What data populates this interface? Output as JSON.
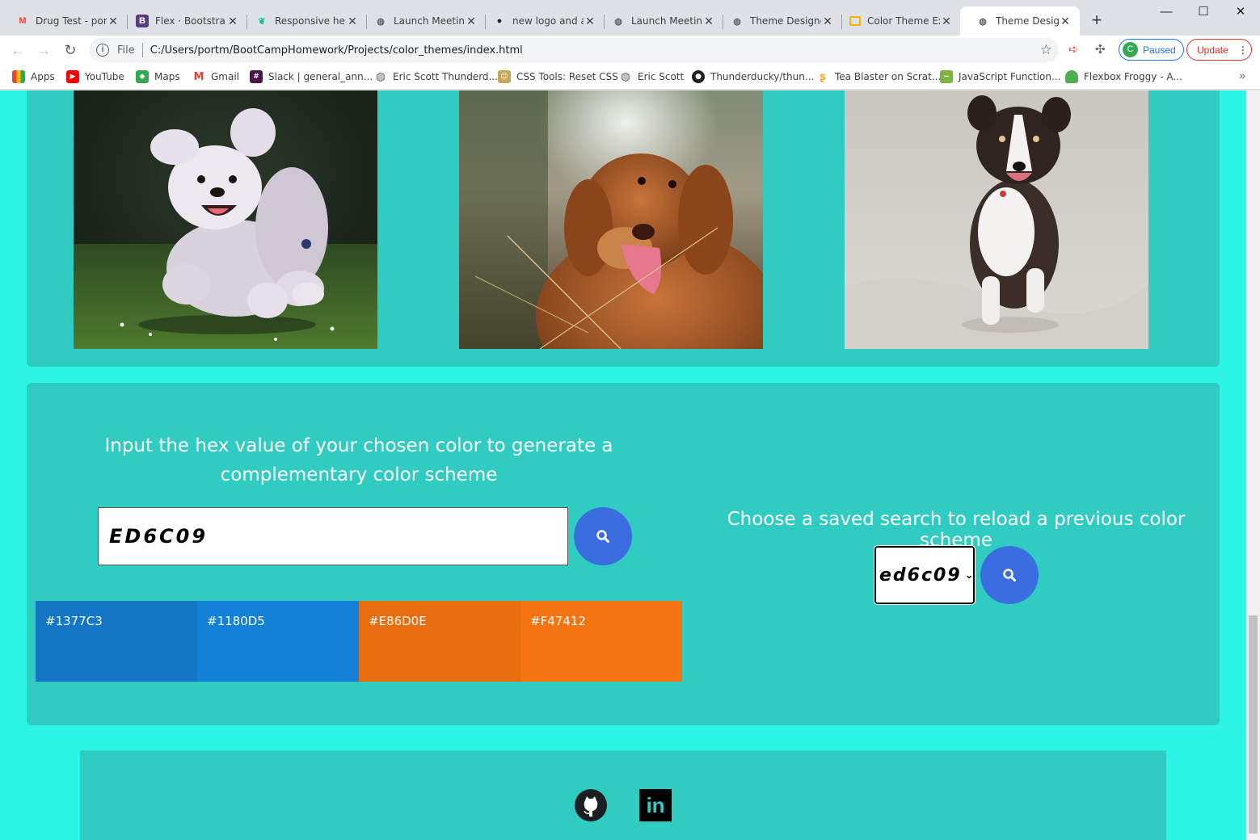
{
  "browser": {
    "tabs": [
      {
        "title": "Drug Test - port",
        "icon": "gmail-icon",
        "color": "#ea4335"
      },
      {
        "title": "Flex · Bootstrap",
        "icon": "bootstrap-icon",
        "color": "#563d7c"
      },
      {
        "title": "Responsive help",
        "icon": "feather-icon",
        "color": "#1abc9c"
      },
      {
        "title": "Launch Meeting",
        "icon": "globe-icon",
        "color": "#5f6368"
      },
      {
        "title": "new logo and a",
        "icon": "github-icon",
        "color": "#202124"
      },
      {
        "title": "Launch Meeting",
        "icon": "globe-icon",
        "color": "#5f6368"
      },
      {
        "title": "Theme Designe",
        "icon": "globe-icon",
        "color": "#5f6368"
      },
      {
        "title": "Color Theme Ex",
        "icon": "slides-icon",
        "color": "#f4b400"
      },
      {
        "title": "Theme Designe",
        "icon": "globe-icon",
        "color": "#5f6368"
      }
    ],
    "address": {
      "scheme": "File",
      "url": "C:/Users/portm/BootCampHomework/Projects/color_themes/index.html"
    },
    "profile": {
      "initial": "C",
      "label": "Paused"
    },
    "update_label": "Update",
    "bookmarks": [
      {
        "label": "Apps",
        "icon": "apps-grid-icon"
      },
      {
        "label": "YouTube",
        "icon": "youtube-icon"
      },
      {
        "label": "Maps",
        "icon": "maps-icon"
      },
      {
        "label": "Gmail",
        "icon": "gmail-icon"
      },
      {
        "label": "Slack | general_ann...",
        "icon": "slack-icon"
      },
      {
        "label": "Eric Scott Thunderd...",
        "icon": "globe-icon"
      },
      {
        "label": "CSS Tools: Reset CSS",
        "icon": "css-tools-icon"
      },
      {
        "label": "Eric Scott",
        "icon": "globe-icon"
      },
      {
        "label": "Thunderducky/thun...",
        "icon": "github-icon"
      },
      {
        "label": "Tea Blaster on Scrat...",
        "icon": "scratch-icon"
      },
      {
        "label": "JavaScript Function...",
        "icon": "js-icon"
      },
      {
        "label": "Flexbox Froggy - A...",
        "icon": "frog-icon"
      }
    ]
  },
  "page": {
    "background": "#2cf5e6",
    "panel_color": "#30cbc1",
    "photos": [
      {
        "icon": "white-poodle-running-photo"
      },
      {
        "icon": "brown-retriever-photo"
      },
      {
        "icon": "australian-shepherd-running-photo"
      }
    ],
    "generator": {
      "heading": "Input the hex value of your chosen color to generate a complementary color scheme",
      "input_value": "ED6C09",
      "swatches": [
        {
          "label": "#1377C3",
          "color": "#1377C3"
        },
        {
          "label": "#1180D5",
          "color": "#1180D5"
        },
        {
          "label": "#E86D0E",
          "color": "#E86D0E"
        },
        {
          "label": "#F47412",
          "color": "#F47412"
        }
      ]
    },
    "saved": {
      "heading": "Choose a saved search to reload a previous color scheme",
      "selected": "ed6c09"
    },
    "footer": {
      "links": [
        {
          "icon": "github-icon"
        },
        {
          "icon": "linkedin-icon",
          "text": "in"
        }
      ]
    }
  }
}
